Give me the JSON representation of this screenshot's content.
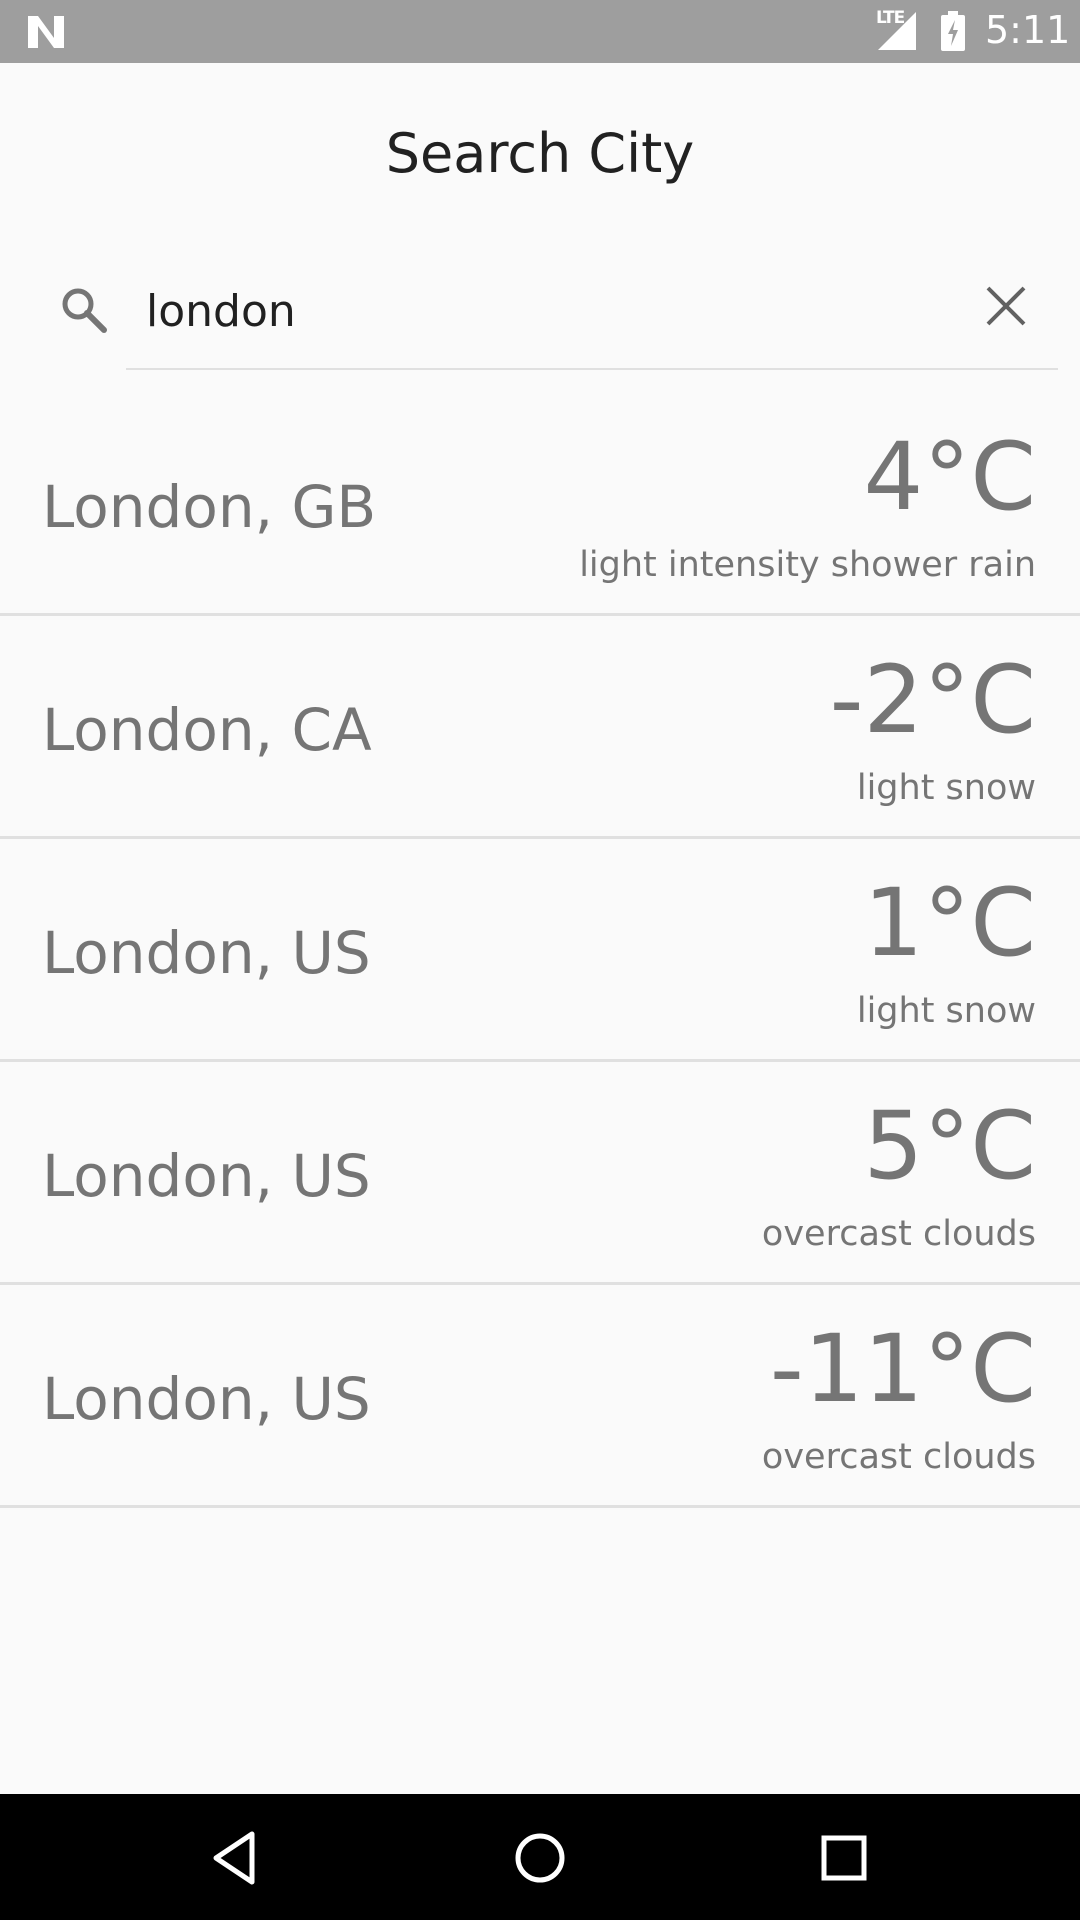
{
  "status_bar": {
    "time": "5:11",
    "network": "LTE",
    "icons": [
      "notification-n-icon",
      "signal-lte-icon",
      "battery-charging-icon"
    ]
  },
  "header": {
    "title": "Search City"
  },
  "search": {
    "value": "london",
    "icons": [
      "search-icon",
      "close-icon"
    ]
  },
  "results": [
    {
      "city": "London, GB",
      "temp": "4°C",
      "description": "light intensity shower rain"
    },
    {
      "city": "London, CA",
      "temp": "-2°C",
      "description": "light snow"
    },
    {
      "city": "London, US",
      "temp": "1°C",
      "description": "light snow"
    },
    {
      "city": "London, US",
      "temp": "5°C",
      "description": "overcast clouds"
    },
    {
      "city": "London, US",
      "temp": "-11°C",
      "description": "overcast clouds"
    }
  ],
  "nav_bar": {
    "icons": [
      "back-icon",
      "home-icon",
      "recents-icon"
    ]
  },
  "colors": {
    "status_bar": "#9e9e9e",
    "background": "#fafafa",
    "text_primary": "#212121",
    "text_secondary": "#757575",
    "divider": "#e0e0e0",
    "nav_bar": "#000000"
  }
}
